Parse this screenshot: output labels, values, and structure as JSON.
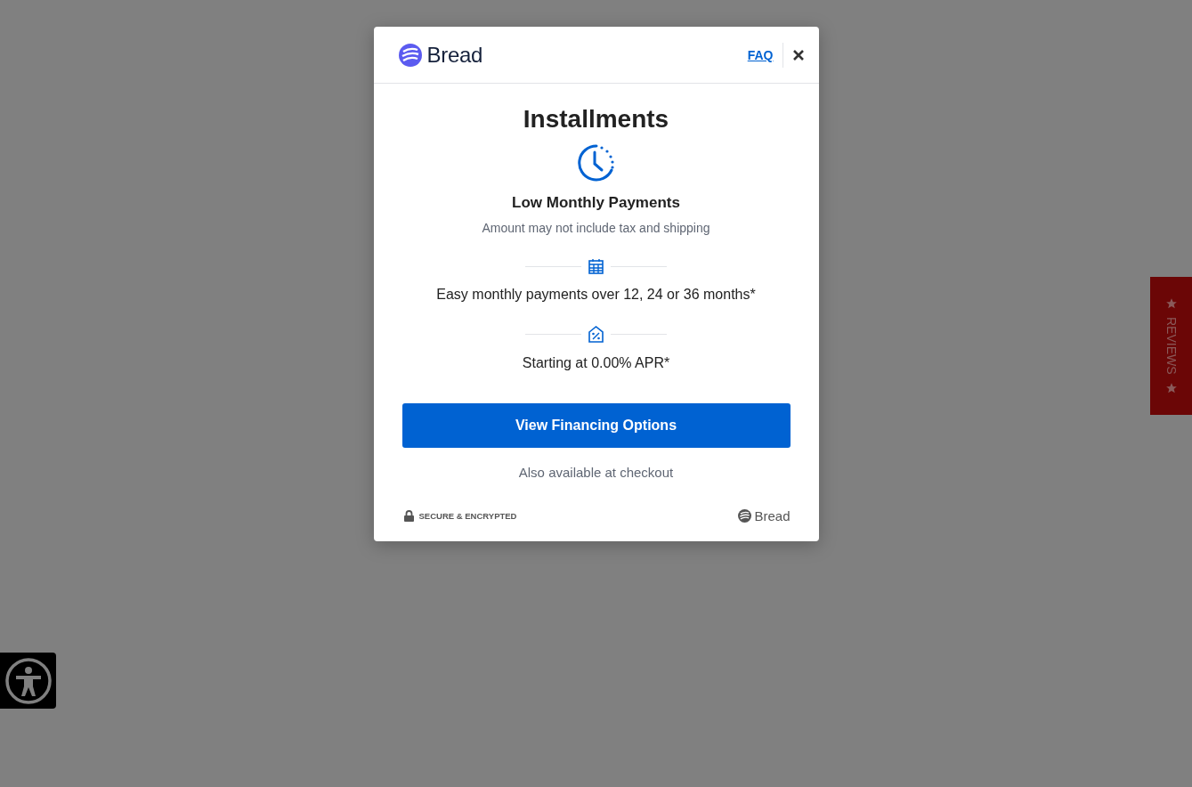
{
  "modal": {
    "brand": "Bread",
    "faq_link": "FAQ",
    "title": "Installments",
    "subtitle": "Low Monthly Payments",
    "note": "Amount may not include tax and shipping",
    "features": [
      {
        "kind": "calendar",
        "text": "Easy monthly payments over 12, 24 or 36 months*"
      },
      {
        "kind": "percent-tag",
        "text": "Starting at 0.00% APR*"
      }
    ],
    "button": "View Financing Options",
    "checkout_note": "Also available at checkout",
    "security": "SECURE & ENCRYPTED",
    "footer_brand": "Bread"
  },
  "reviews_tab": {
    "label": "REVIEWS"
  }
}
